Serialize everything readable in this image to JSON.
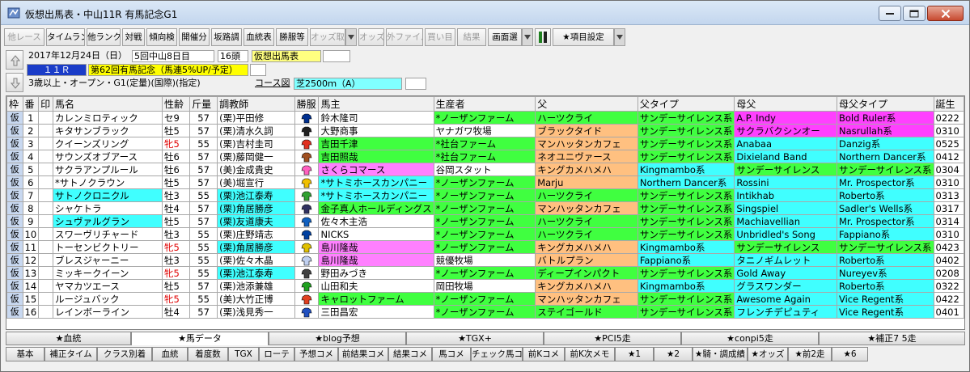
{
  "window": {
    "title": "仮想出馬表・中山11R 有馬記念G1"
  },
  "toolbar": [
    "他レース",
    "タイムランク",
    "他ランク",
    "対戦",
    "傾向検",
    "開催分",
    "坂路調",
    "血統表",
    "勝服等",
    "オッズ取",
    "オッズ",
    "外ファイル",
    "買い目",
    "結果",
    "画面選",
    "★項目設定"
  ],
  "toolbar_disabled": [
    true,
    false,
    false,
    false,
    false,
    false,
    false,
    false,
    false,
    true,
    true,
    true,
    true,
    true,
    false,
    false
  ],
  "info": {
    "date": "2017年12月24日（日）",
    "meeting": "5回中山8日目",
    "heads": "16頭",
    "mode": "仮想出馬表",
    "race_no": "１１Ｒ",
    "race_name": "第62回有馬記念（馬連5%UP/予定）",
    "conditions": "3歳以上・オープン・G1(定量)(国際)(指定)",
    "course_label": "コース図",
    "course": "芝2500ｍ（A）"
  },
  "columns": [
    "枠",
    "番",
    "印",
    "馬名",
    "性齢",
    "斤量",
    "調教師",
    "勝服",
    "馬主",
    "生産者",
    "父",
    "父タイプ",
    "母父",
    "母父タイプ",
    "誕生"
  ],
  "rows": [
    {
      "waku": "仮",
      "no": "1",
      "mark": "",
      "name": "カレンミロティック",
      "sex": "セ9",
      "kin": "57",
      "trainer": "(栗)平田修",
      "owner": "鈴木隆司",
      "breeder": "*ノーザンファーム",
      "sire": "ハーツクライ",
      "sire_type": "サンデーサイレンス系",
      "dam_sire": "A.P. Indy",
      "dam_sire_type": "Bold Ruler系",
      "birth": "0222"
    },
    {
      "waku": "仮",
      "no": "2",
      "mark": "",
      "name": "キタサンブラック",
      "sex": "牡5",
      "kin": "57",
      "trainer": "(栗)清水久詞",
      "owner": "大野商事",
      "breeder": "ヤナガワ牧場",
      "sire": "ブラックタイド",
      "sire_type": "サンデーサイレンス系",
      "dam_sire": "サクラバクシンオー",
      "dam_sire_type": "Nasrullah系",
      "birth": "0310"
    },
    {
      "waku": "仮",
      "no": "3",
      "mark": "",
      "name": "クイーンズリング",
      "sex": "牝5",
      "kin": "55",
      "trainer": "(栗)吉村圭司",
      "owner": "吉田千津",
      "breeder": "*社台ファーム",
      "sire": "マンハッタンカフェ",
      "sire_type": "サンデーサイレンス系",
      "dam_sire": "Anabaa",
      "dam_sire_type": "Danzig系",
      "birth": "0525"
    },
    {
      "waku": "仮",
      "no": "4",
      "mark": "",
      "name": "サウンズオブアース",
      "sex": "牡6",
      "kin": "57",
      "trainer": "(栗)藤岡健一",
      "owner": "吉田照哉",
      "breeder": "*社台ファーム",
      "sire": "ネオユニヴァース",
      "sire_type": "サンデーサイレンス系",
      "dam_sire": "Dixieland Band",
      "dam_sire_type": "Northern Dancer系",
      "birth": "0412"
    },
    {
      "waku": "仮",
      "no": "5",
      "mark": "",
      "name": "サクラアンプルール",
      "sex": "牡6",
      "kin": "57",
      "trainer": "(美)金成貴史",
      "owner": "さくらコマース",
      "breeder": "谷岡スタット",
      "sire": "キングカメハメハ",
      "sire_type": "Kingmambo系",
      "dam_sire": "サンデーサイレンス",
      "dam_sire_type": "サンデーサイレンス系",
      "birth": "0304"
    },
    {
      "waku": "仮",
      "no": "6",
      "mark": "",
      "name": "*サトノクラウン",
      "sex": "牡5",
      "kin": "57",
      "trainer": "(美)堀宣行",
      "owner": "*サトミホースカンパニー",
      "breeder": "*ノーザンファーム",
      "sire": "Marju",
      "sire_type": "Northern Dancer系",
      "dam_sire": "Rossini",
      "dam_sire_type": "Mr. Prospector系",
      "birth": "0310"
    },
    {
      "waku": "仮",
      "no": "7",
      "mark": "",
      "name": "サトノクロニクル",
      "sex": "牡3",
      "kin": "55",
      "trainer": "(栗)池江泰寿",
      "owner": "*サトミホースカンパニー",
      "breeder": "*ノーザンファーム",
      "sire": "ハーツクライ",
      "sire_type": "サンデーサイレンス系",
      "dam_sire": "Intikhab",
      "dam_sire_type": "Roberto系",
      "birth": "0313"
    },
    {
      "waku": "仮",
      "no": "8",
      "mark": "",
      "name": "シャケトラ",
      "sex": "牡4",
      "kin": "57",
      "trainer": "(栗)角居勝彦",
      "owner": "金子真人ホールディングス",
      "breeder": "*ノーザンファーム",
      "sire": "マンハッタンカフェ",
      "sire_type": "サンデーサイレンス系",
      "dam_sire": "Singspiel",
      "dam_sire_type": "Sadler's Wells系",
      "birth": "0317"
    },
    {
      "waku": "仮",
      "no": "9",
      "mark": "",
      "name": "シュヴァルグラン",
      "sex": "牡5",
      "kin": "57",
      "trainer": "(栗)友道康夫",
      "owner": "佐々木主浩",
      "breeder": "*ノーザンファーム",
      "sire": "ハーツクライ",
      "sire_type": "サンデーサイレンス系",
      "dam_sire": "Machiavellian",
      "dam_sire_type": "Mr. Prospector系",
      "birth": "0314"
    },
    {
      "waku": "仮",
      "no": "10",
      "mark": "",
      "name": "スワーヴリチャード",
      "sex": "牡3",
      "kin": "55",
      "trainer": "(栗)庄野靖志",
      "owner": "NICKS",
      "breeder": "*ノーザンファーム",
      "sire": "ハーツクライ",
      "sire_type": "サンデーサイレンス系",
      "dam_sire": "Unbridled's Song",
      "dam_sire_type": "Fappiano系",
      "birth": "0310"
    },
    {
      "waku": "仮",
      "no": "11",
      "mark": "",
      "name": "トーセンビクトリー",
      "sex": "牝5",
      "kin": "55",
      "trainer": "(栗)角居勝彦",
      "owner": "島川隆哉",
      "breeder": "*ノーザンファーム",
      "sire": "キングカメハメハ",
      "sire_type": "Kingmambo系",
      "dam_sire": "サンデーサイレンス",
      "dam_sire_type": "サンデーサイレンス系",
      "birth": "0423"
    },
    {
      "waku": "仮",
      "no": "12",
      "mark": "",
      "name": "ブレスジャーニー",
      "sex": "牡3",
      "kin": "55",
      "trainer": "(栗)佐々木晶",
      "owner": "島川隆哉",
      "breeder": "競優牧場",
      "sire": "バトルプラン",
      "sire_type": "Fappiano系",
      "dam_sire": "タニノギムレット",
      "dam_sire_type": "Roberto系",
      "birth": "0402"
    },
    {
      "waku": "仮",
      "no": "13",
      "mark": "",
      "name": "ミッキークイーン",
      "sex": "牝5",
      "kin": "55",
      "trainer": "(栗)池江泰寿",
      "owner": "野田みづき",
      "breeder": "*ノーザンファーム",
      "sire": "ディープインパクト",
      "sire_type": "サンデーサイレンス系",
      "dam_sire": "Gold Away",
      "dam_sire_type": "Nureyev系",
      "birth": "0208"
    },
    {
      "waku": "仮",
      "no": "14",
      "mark": "",
      "name": "ヤマカツエース",
      "sex": "牡5",
      "kin": "57",
      "trainer": "(栗)池添兼雄",
      "owner": "山田和夫",
      "breeder": "岡田牧場",
      "sire": "キングカメハメハ",
      "sire_type": "Kingmambo系",
      "dam_sire": "グラスワンダー",
      "dam_sire_type": "Roberto系",
      "birth": "0322"
    },
    {
      "waku": "仮",
      "no": "15",
      "mark": "",
      "name": "ルージュバック",
      "sex": "牝5",
      "kin": "55",
      "trainer": "(美)大竹正博",
      "owner": "キャロットファーム",
      "breeder": "*ノーザンファーム",
      "sire": "マンハッタンカフェ",
      "sire_type": "サンデーサイレンス系",
      "dam_sire": "Awesome Again",
      "dam_sire_type": "Vice Regent系",
      "birth": "0422"
    },
    {
      "waku": "仮",
      "no": "16",
      "mark": "",
      "name": "レインボーライン",
      "sex": "牡4",
      "kin": "57",
      "trainer": "(栗)浅見秀一",
      "owner": "三田昌宏",
      "breeder": "*ノーザンファーム",
      "sire": "ステイゴールド",
      "sire_type": "サンデーサイレンス系",
      "dam_sire": "フレンチデピュティ",
      "dam_sire_type": "Vice Regent系",
      "birth": "0401"
    }
  ],
  "tabs1": [
    "★血統",
    "★馬データ",
    "★blog予想",
    "★TGX+",
    "★PCI5走",
    "★conpi5走",
    "★補正7 5走"
  ],
  "tabs2": [
    "基本",
    "補正タイム",
    "クラス別着",
    "血統",
    "着度数",
    "TGX",
    "ローテ",
    "予想コメ",
    "前結果コメ",
    "結果コメ",
    "馬コメ",
    "チェック馬コメ",
    "前Kコメ",
    "前K次メモ",
    "★1",
    "★2",
    "★騎・調成績",
    "★オッズ",
    "★前2走",
    "★6"
  ],
  "colors": {
    "magenta": "#ff40ff",
    "orange": "#ffc080",
    "lime": "#40ff40",
    "cyan": "#40ffff",
    "pink": "#ff80ff",
    "selected": "#ffff00"
  }
}
